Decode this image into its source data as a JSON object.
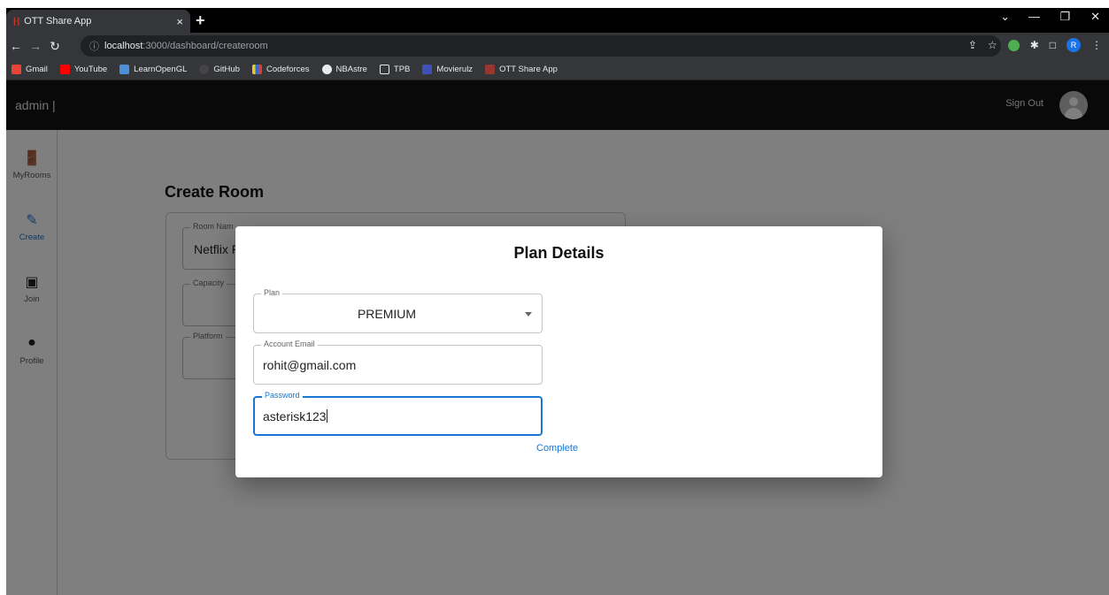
{
  "browser": {
    "tab_title": "OTT Share App",
    "tab_close": "×",
    "new_tab": "+",
    "url_host": "localhost",
    "url_path": ":3000/dashboard/createroom",
    "profile_initial": "R",
    "bookmarks": [
      "Gmail",
      "YouTube",
      "LearnOpenGL",
      "GitHub",
      "Codeforces",
      "NBAstre",
      "TPB",
      "Movierulz",
      "OTT Share App"
    ]
  },
  "appbar": {
    "user": "admin |",
    "sign_out": "Sign Out"
  },
  "sidebar": {
    "items": [
      {
        "label": "MyRooms",
        "icon": "door-icon"
      },
      {
        "label": "Create",
        "icon": "pencil-icon"
      },
      {
        "label": "Join",
        "icon": "tv-icon"
      },
      {
        "label": "Profile",
        "icon": "person-icon"
      }
    ],
    "active": "Create"
  },
  "page": {
    "title": "Create Room",
    "room_name_label": "Room Nam",
    "room_name_value": "Netflix R",
    "capacity_label": "Capacity",
    "platform_label": "Platform"
  },
  "dialog": {
    "title": "Plan Details",
    "plan_label": "Plan",
    "plan_value": "PREMIUM",
    "email_label": "Account Email",
    "email_value": "rohit@gmail.com",
    "password_label": "Password",
    "password_value": "asterisk123",
    "complete_label": "Complete"
  },
  "colors": {
    "accent": "#1976d2",
    "appbar": "#121212"
  }
}
